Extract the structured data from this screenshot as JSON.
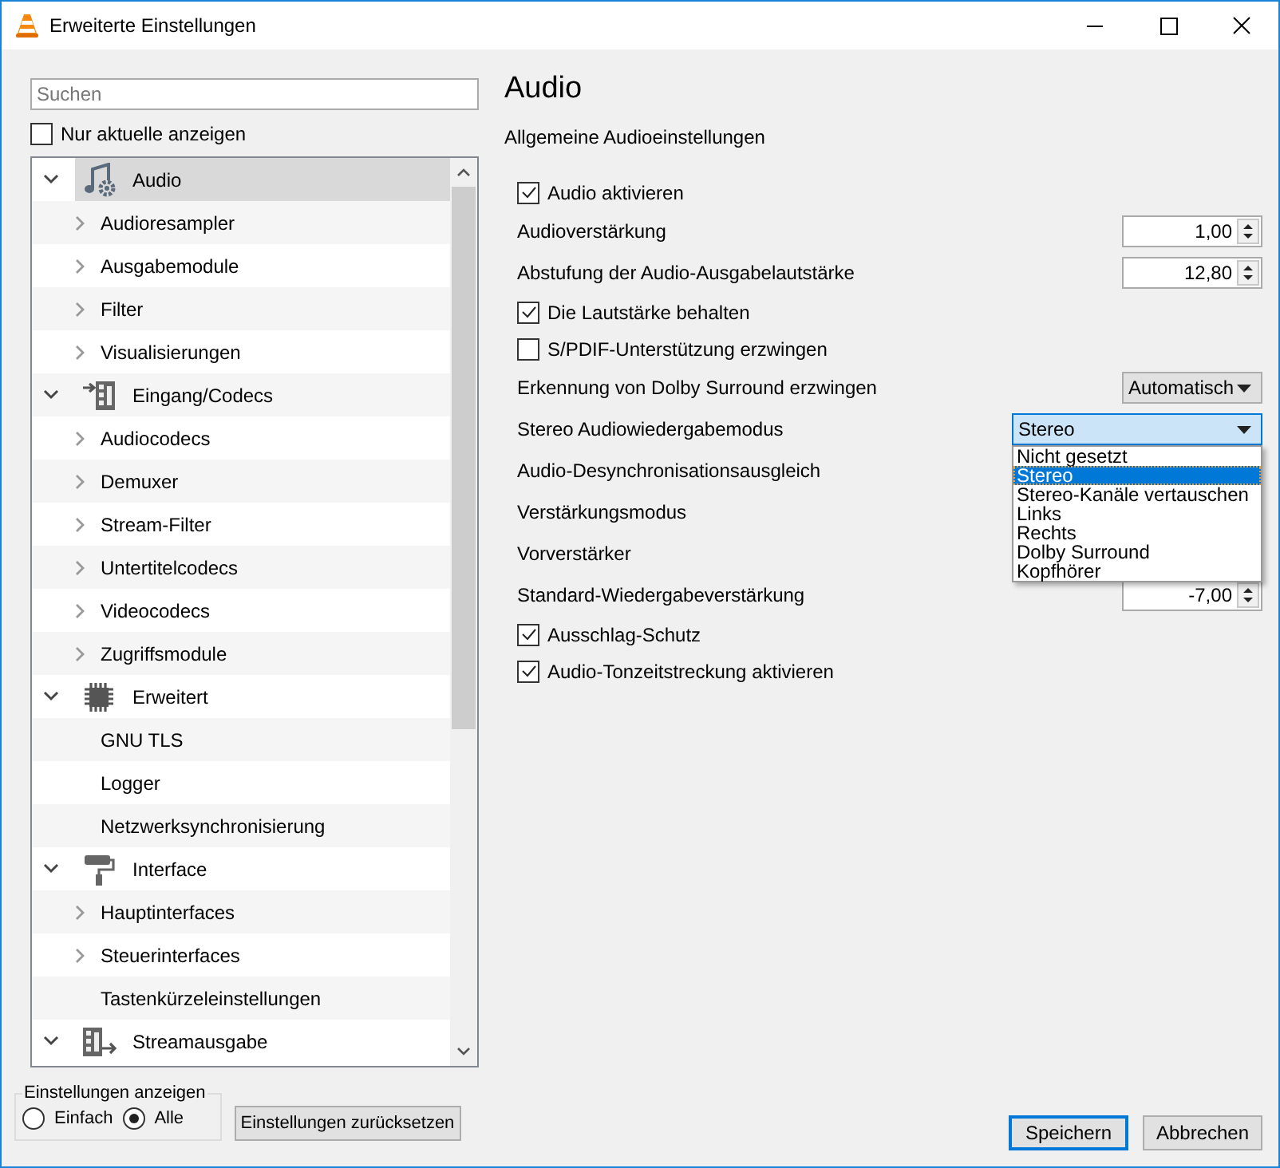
{
  "window": {
    "title": "Erweiterte Einstellungen"
  },
  "search": {
    "placeholder": "Suchen"
  },
  "only_current": {
    "label": "Nur aktuelle anzeigen",
    "checked": false
  },
  "tree": [
    {
      "label": "Audio",
      "expanded": true,
      "selected": true,
      "children": [
        {
          "label": "Audioresampler",
          "expandable": true
        },
        {
          "label": "Ausgabemodule",
          "expandable": true
        },
        {
          "label": "Filter",
          "expandable": true
        },
        {
          "label": "Visualisierungen",
          "expandable": true
        }
      ]
    },
    {
      "label": "Eingang/Codecs",
      "expanded": true,
      "selected": false,
      "children": [
        {
          "label": "Audiocodecs",
          "expandable": true
        },
        {
          "label": "Demuxer",
          "expandable": true
        },
        {
          "label": "Stream-Filter",
          "expandable": true
        },
        {
          "label": "Untertitelcodecs",
          "expandable": true
        },
        {
          "label": "Videocodecs",
          "expandable": true
        },
        {
          "label": "Zugriffsmodule",
          "expandable": true
        }
      ]
    },
    {
      "label": "Erweitert",
      "expanded": true,
      "selected": false,
      "children": [
        {
          "label": "GNU TLS",
          "expandable": false
        },
        {
          "label": "Logger",
          "expandable": false
        },
        {
          "label": "Netzwerksynchronisierung",
          "expandable": false
        }
      ]
    },
    {
      "label": "Interface",
      "expanded": true,
      "selected": false,
      "children": [
        {
          "label": "Hauptinterfaces",
          "expandable": true
        },
        {
          "label": "Steuerinterfaces",
          "expandable": true
        },
        {
          "label": "Tastenkürzeleinstellungen",
          "expandable": false
        }
      ]
    },
    {
      "label": "Streamausgabe",
      "expanded": true,
      "selected": false
    }
  ],
  "panel": {
    "title": "Audio",
    "subtitle": "Allgemeine Audioeinstellungen"
  },
  "settings": [
    {
      "kind": "checkbox",
      "label": "Audio aktivieren",
      "checked": true
    },
    {
      "kind": "spin",
      "label": "Audioverstärkung",
      "value": "1,00"
    },
    {
      "kind": "spin",
      "label": "Abstufung der Audio-Ausgabelautstärke",
      "value": "12,80"
    },
    {
      "kind": "checkbox",
      "label": "Die Lautstärke behalten",
      "checked": true
    },
    {
      "kind": "checkbox",
      "label": "S/PDIF-Unterstützung erzwingen",
      "checked": false
    },
    {
      "kind": "select",
      "label": "Erkennung von Dolby Surround erzwingen",
      "value": "Automatisch",
      "open": false
    },
    {
      "kind": "select",
      "label": "Stereo Audiowiedergabemodus",
      "value": "Stereo",
      "open": true,
      "options": [
        {
          "label": "Nicht gesetzt",
          "selected": false
        },
        {
          "label": "Stereo",
          "selected": true
        },
        {
          "label": "Stereo-Kanäle vertauschen",
          "selected": false
        },
        {
          "label": "Links",
          "selected": false
        },
        {
          "label": "Rechts",
          "selected": false
        },
        {
          "label": "Dolby Surround",
          "selected": false
        },
        {
          "label": "Kopfhörer",
          "selected": false
        }
      ]
    },
    {
      "kind": "label",
      "label": "Audio-Desynchronisationsausgleich"
    },
    {
      "kind": "label",
      "label": "Verstärkungsmodus"
    },
    {
      "kind": "label",
      "label": "Vorverstärker"
    },
    {
      "kind": "spin",
      "label": "Standard-Wiedergabeverstärkung",
      "value": "-7,00"
    },
    {
      "kind": "checkbox",
      "label": "Ausschlag-Schutz",
      "checked": true
    },
    {
      "kind": "checkbox",
      "label": "Audio-Tonzeitstreckung aktivieren",
      "checked": true
    }
  ],
  "view_mode": {
    "title": "Einstellungen anzeigen",
    "options": [
      {
        "label": "Einfach",
        "selected": false
      },
      {
        "label": "Alle",
        "selected": true
      }
    ]
  },
  "buttons": {
    "reset": "Einstellungen zurücksetzen",
    "save": "Speichern",
    "cancel": "Abbrechen"
  }
}
